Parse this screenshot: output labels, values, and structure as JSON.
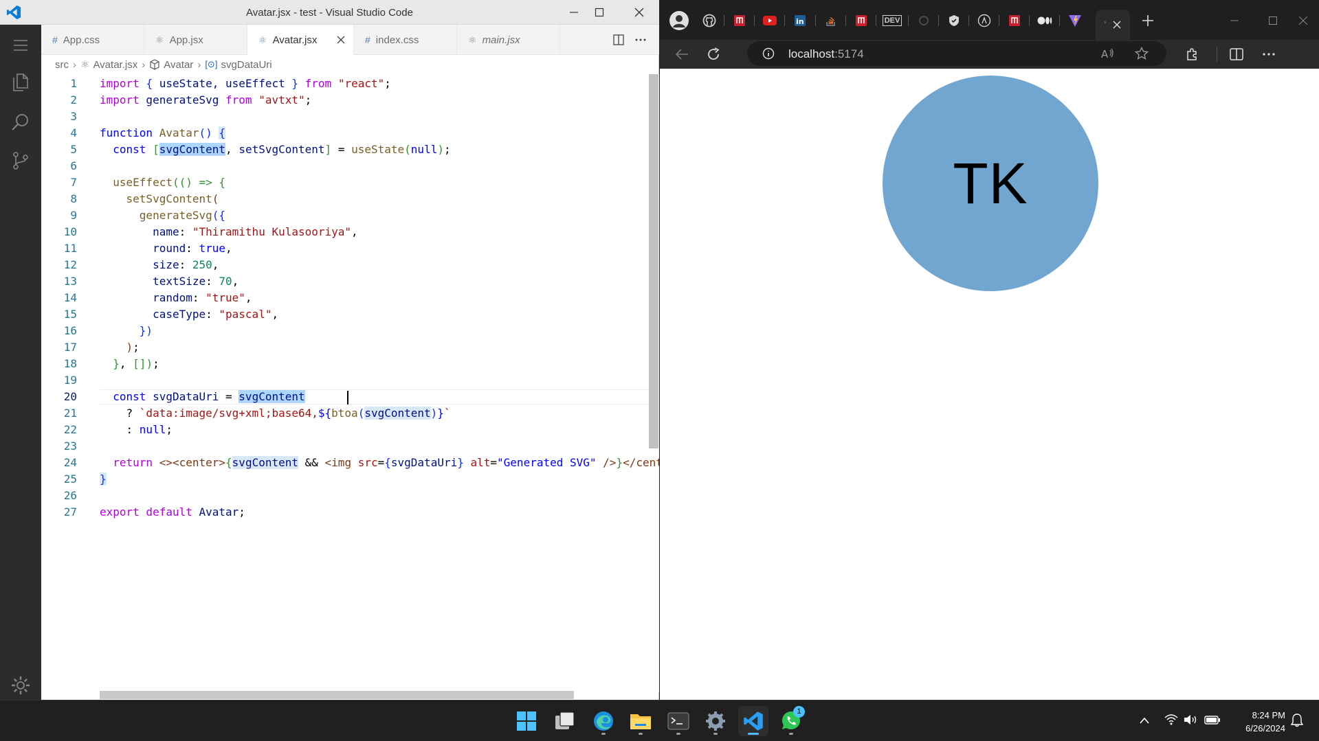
{
  "vscode": {
    "window_title": "Avatar.jsx - test - Visual Studio Code",
    "tabs": [
      {
        "icon": "#",
        "label": "App.css",
        "active": false
      },
      {
        "icon": "⚛",
        "label": "App.jsx",
        "active": false
      },
      {
        "icon": "⚛",
        "label": "Avatar.jsx",
        "active": true
      },
      {
        "icon": "#",
        "label": "index.css",
        "active": false
      },
      {
        "icon": "⚛",
        "label": "main.jsx",
        "active": false
      }
    ],
    "breadcrumb": {
      "folder": "src",
      "file": "Avatar.jsx",
      "component": "Avatar",
      "symbol": "svgDataUri"
    },
    "line_numbers": [
      "1",
      "2",
      "3",
      "4",
      "5",
      "6",
      "7",
      "8",
      "9",
      "10",
      "11",
      "12",
      "13",
      "14",
      "15",
      "16",
      "17",
      "18",
      "19",
      "20",
      "21",
      "22",
      "23",
      "24",
      "25",
      "26",
      "27"
    ],
    "code": {
      "l1_import": "import",
      "l1_brace_open": "{",
      "l1_names": " useState, useEffect ",
      "l1_brace_close": "}",
      "l1_from": "from",
      "l1_module": "\"react\"",
      "l1_end": ";",
      "l2_import": "import",
      "l2_name": " generateSvg ",
      "l2_from": "from",
      "l2_module": "\"avtxt\"",
      "l2_end": ";",
      "l4_function": "function",
      "l4_name": "Avatar",
      "l4_parens": "()",
      "l4_brace": "{",
      "l5_const": "const",
      "l5_open": "[",
      "l5_var1": "svgContent",
      "l5_comma": ", ",
      "l5_var2": "setSvgContent",
      "l5_close": "]",
      "l5_eq": " = ",
      "l5_fn": "useState",
      "l5_paren_open": "(",
      "l5_null": "null",
      "l5_paren_close": ")",
      "l5_end": ";",
      "l7_fn": "useEffect",
      "l7_rest": "(() => {",
      "l8_fn": "setSvgContent",
      "l8_paren": "(",
      "l9_fn": "generateSvg",
      "l9_open": "({",
      "l10_key": "name",
      "l10_colon": ": ",
      "l10_val": "\"Thiramithu Kulasooriya\"",
      "l10_comma": ",",
      "l11_key": "round",
      "l11_colon": ": ",
      "l11_val": "true",
      "l11_comma": ",",
      "l12_key": "size",
      "l12_colon": ": ",
      "l12_val": "250",
      "l12_comma": ",",
      "l13_key": "textSize",
      "l13_colon": ": ",
      "l13_val": "70",
      "l13_comma": ",",
      "l14_key": "random",
      "l14_colon": ": ",
      "l14_val": "\"true\"",
      "l14_comma": ",",
      "l15_key": "caseType",
      "l15_colon": ": ",
      "l15_val": "\"pascal\"",
      "l15_comma": ",",
      "l16": "})",
      "l17_paren": ")",
      "l17_end": ";",
      "l18_brace": "}",
      "l18_mid": ", ",
      "l18_arr": "[]",
      "l18_paren": ")",
      "l18_end": ";",
      "l20_const": "const",
      "l20_var": " svgDataUri ",
      "l20_eq": "= ",
      "l20_ref": "svgContent",
      "l21_q": "? ",
      "l21_tpl": "`data:image/svg+xml;base64,",
      "l21_interp_open": "${",
      "l21_fn": "btoa",
      "l21_paren_open": "(",
      "l21_ref": "svgContent",
      "l21_paren_close": ")",
      "l21_interp_close": "}",
      "l21_tick": "`",
      "l22_colon": ": ",
      "l22_null": "null",
      "l22_end": ";",
      "l24_return": "return",
      "l24_frag": " <><",
      "l24_center": "center",
      "l24_gt": ">",
      "l24_brace_open": "{",
      "l24_ref": "svgContent",
      "l24_and": " && ",
      "l24_lt": "<",
      "l24_img": "img",
      "l24_src": " src",
      "l24_eq1": "=",
      "l24_src_open": "{",
      "l24_src_val": "svgDataUri",
      "l24_src_close": "}",
      "l24_alt": " alt",
      "l24_eq2": "=",
      "l24_alt_val": "\"Generated SVG\"",
      "l24_selfclose": " />",
      "l24_brace_close": "}",
      "l24_close": "</cent",
      "l25_brace": "}",
      "l27_export": "export",
      "l27_default": " default ",
      "l27_name": "Avatar",
      "l27_end": ";"
    }
  },
  "browser": {
    "url_host": "localhost",
    "url_port": ":5174",
    "tab_labels": {
      "dev": "DEV"
    },
    "page": {
      "avatar_text": "TK",
      "avatar_color": "#71a6d1"
    }
  },
  "taskbar": {
    "time": "8:24 PM",
    "date": "6/26/2024",
    "whatsapp_badge": "1"
  }
}
